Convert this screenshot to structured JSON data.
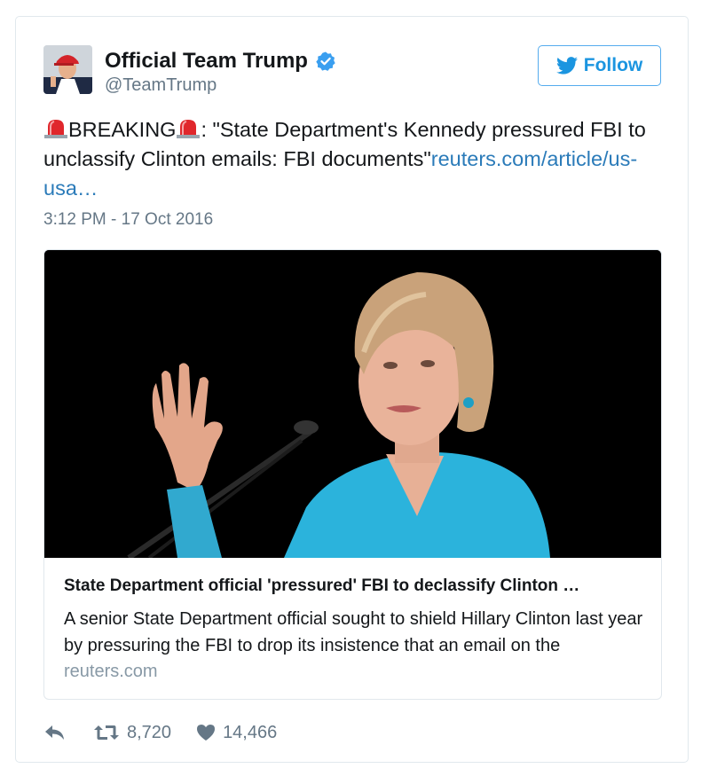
{
  "account": {
    "name": "Official Team Trump",
    "handle": "@TeamTrump",
    "verified": true
  },
  "follow_label": "Follow",
  "tweet": {
    "prefix": "BREAKING",
    "text": ": \"State Department's Kennedy pressured FBI to unclassify Clinton emails: FBI documents\"",
    "link_text": "reuters.com/article/us-usa…",
    "timestamp": "3:12 PM - 17 Oct 2016"
  },
  "card": {
    "title": "State Department official 'pressured' FBI to declassify Clinton …",
    "description": "A senior State Department official sought to shield Hillary Clinton last year by pressuring the FBI to drop its insistence that an email on the",
    "domain": "reuters.com"
  },
  "actions": {
    "retweets": "8,720",
    "likes": "14,466"
  },
  "colors": {
    "brand_blue": "#1b95e0",
    "link_blue": "#2b7bb9",
    "muted_gray": "#657786",
    "siren_red": "#e0272c"
  }
}
